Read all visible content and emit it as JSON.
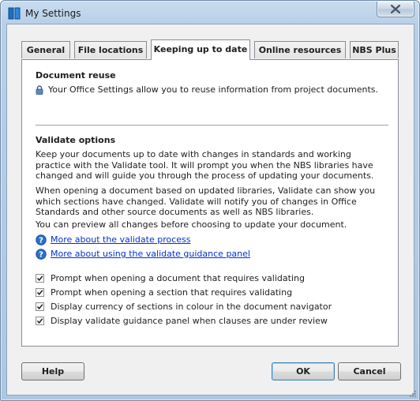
{
  "window": {
    "title": "My Settings",
    "close_icon": "close-icon",
    "app_icon": "nbs-books-icon"
  },
  "tabs": [
    {
      "label": "General",
      "active": false
    },
    {
      "label": "File locations",
      "active": false
    },
    {
      "label": "Keeping up to date",
      "active": true
    },
    {
      "label": "Online resources",
      "active": false
    },
    {
      "label": "NBS Plus",
      "active": false
    }
  ],
  "document_reuse": {
    "heading": "Document reuse",
    "text": "Your Office Settings allow you to reuse information from project documents.",
    "icon": "lock-icon"
  },
  "validate": {
    "heading": "Validate options",
    "para1": "Keep your documents up to date with changes in standards and working practice with the Validate tool. It will prompt you when the NBS libraries have changed and will guide you through the process of updating your documents.",
    "para2": "When opening a document based on updated libraries, Validate can show you which sections have changed. Validate will notify you of changes in Office Standards and other source documents as well as NBS libraries.",
    "para3": "You can preview all changes before choosing to update your document.",
    "links": [
      {
        "label": "More about the validate process",
        "icon": "help-icon"
      },
      {
        "label": "More about using the validate guidance panel",
        "icon": "help-icon"
      }
    ],
    "options": [
      {
        "label": "Prompt when opening a document that requires validating",
        "checked": true
      },
      {
        "label": "Prompt when opening a section that requires validating",
        "checked": true
      },
      {
        "label": "Display currency of sections in colour in the document navigator",
        "checked": true
      },
      {
        "label": "Display validate guidance panel when clauses are under review",
        "checked": true
      }
    ]
  },
  "buttons": {
    "help": "Help",
    "ok": "OK",
    "cancel": "Cancel"
  },
  "colors": {
    "link": "#0033cc",
    "title_bar": "#b8cfe7",
    "help_icon": "#2a6fc9"
  }
}
